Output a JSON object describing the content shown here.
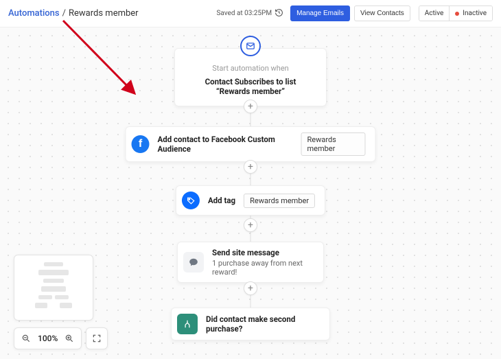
{
  "header": {
    "breadcrumb_link": "Automations",
    "breadcrumb_sep": "/",
    "breadcrumb_current": "Rewards member",
    "saved_label": "Saved at 03:25PM",
    "manage_emails": "Manage Emails",
    "view_contacts": "View Contacts",
    "status_active": "Active",
    "status_inactive": "Inactive"
  },
  "flow": {
    "start_sub": "Start automation when",
    "start_main": "Contact Subscribes to list “Rewards member”",
    "fb_label": "Add contact to Facebook Custom Audience",
    "fb_chip": "Rewards member",
    "tag_label": "Add tag",
    "tag_chip": "Rewards member",
    "msg_label": "Send site message",
    "msg_sub": "1 purchase away from next reward!",
    "cond_label": "Did contact make second purchase?"
  },
  "controls": {
    "zoom": "100%"
  },
  "colors": {
    "brand": "#2e5ee0",
    "fb": "#1877f2",
    "arrow": "#d0021b"
  }
}
